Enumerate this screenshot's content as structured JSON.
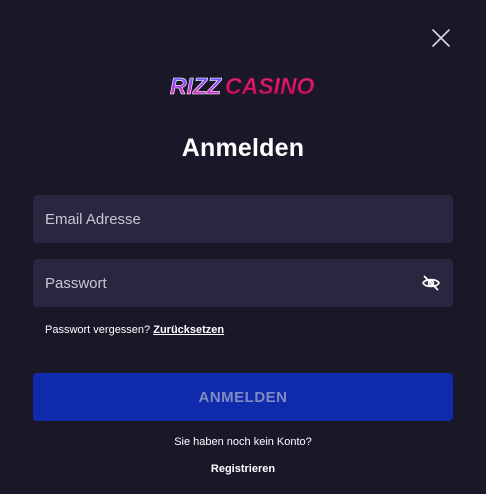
{
  "header": {
    "logo": {
      "part1": "RIZZ",
      "part2": "CASINO"
    },
    "close_icon": "close-icon"
  },
  "form": {
    "title": "Anmelden",
    "email": {
      "placeholder": "Email Adresse",
      "value": ""
    },
    "password": {
      "placeholder": "Passwort",
      "value": "",
      "toggle_icon": "eye-slash-icon"
    },
    "forgot_prefix": "Passwort vergessen?",
    "forgot_link": "Zurücksetzen",
    "submit_label": "ANMELDEN",
    "no_account_text": "Sie haben noch kein Konto?",
    "register_link": "Registrieren"
  },
  "colors": {
    "background": "#1a1729",
    "input_background": "#2b2640",
    "button_background": "#0f2aab",
    "button_text": "#7f8bc2",
    "logo_rizz": "#a23cf5",
    "logo_casino": "#e0166c"
  }
}
